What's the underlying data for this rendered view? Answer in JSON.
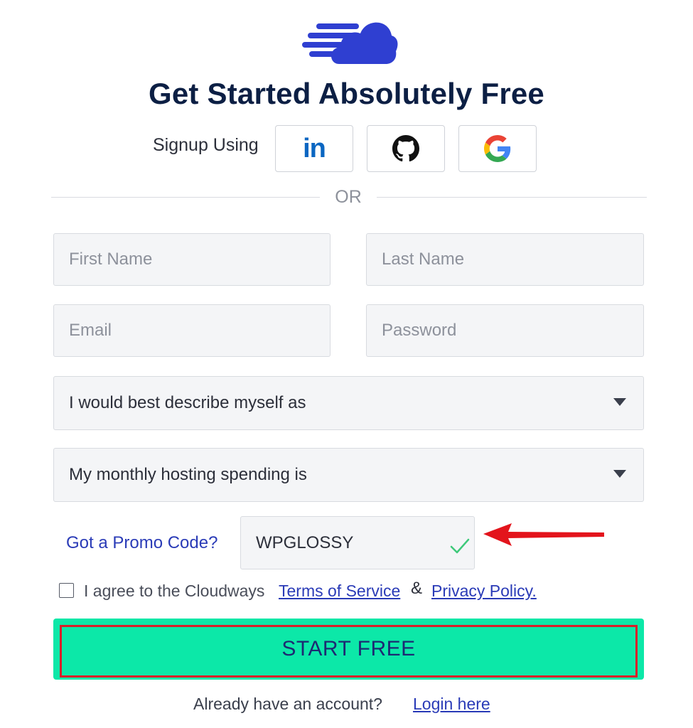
{
  "header": {
    "logo_icon": "cloud-speed-icon",
    "title": "Get Started Absolutely Free"
  },
  "signup": {
    "label": "Signup Using",
    "providers": [
      {
        "name": "LinkedIn",
        "icon": "linkedin-icon",
        "glyph": "in"
      },
      {
        "name": "GitHub",
        "icon": "github-icon"
      },
      {
        "name": "Google",
        "icon": "google-icon"
      }
    ]
  },
  "divider": {
    "label": "OR"
  },
  "form": {
    "first_name_placeholder": "First Name",
    "last_name_placeholder": "Last Name",
    "email_placeholder": "Email",
    "password_placeholder": "Password",
    "describe_select": "I would best describe myself as",
    "spending_select": "My monthly hosting spending is",
    "promo_label": "Got a Promo Code?",
    "promo_value": "WPGLOSSY",
    "agree_text": "I agree to the Cloudways",
    "terms_link": "Terms of Service",
    "amp": "&",
    "privacy_link": "Privacy Policy.",
    "submit_label": "START FREE"
  },
  "footer": {
    "text": "Already have an account?",
    "login_link": "Login here"
  },
  "colors": {
    "brand_blue": "#2f3fd1",
    "title_navy": "#0c1f44",
    "cta_green": "#0ce8a8",
    "annotation_red": "#e3141c",
    "link_blue": "#2a3bb7"
  }
}
